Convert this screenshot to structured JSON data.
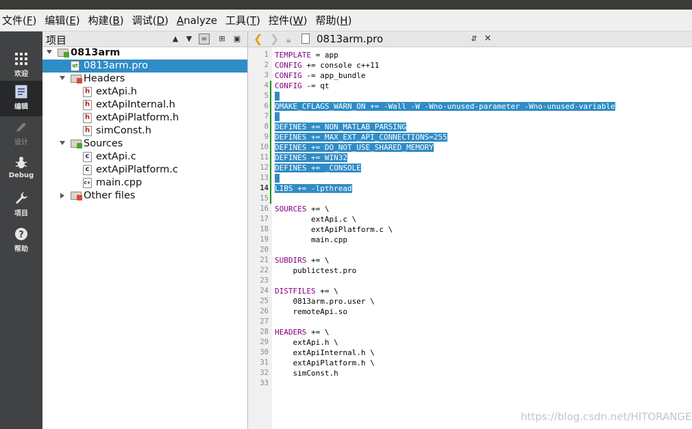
{
  "menu": [
    {
      "text": "文件",
      "key": "F"
    },
    {
      "text": "编辑",
      "key": "E"
    },
    {
      "text": "构建",
      "key": "B"
    },
    {
      "text": "调试",
      "key": "D"
    },
    {
      "text": "Analyze",
      "key": ""
    },
    {
      "text": "工具",
      "key": "T"
    },
    {
      "text": "控件",
      "key": "W"
    },
    {
      "text": "帮助",
      "key": "H"
    }
  ],
  "modes": [
    {
      "label": "欢迎",
      "icon": "grid-icon",
      "state": "normal"
    },
    {
      "label": "编辑",
      "icon": "edit-doc-icon",
      "state": "active"
    },
    {
      "label": "设计",
      "icon": "pencil-icon",
      "state": "disabled"
    },
    {
      "label": "Debug",
      "icon": "bug-icon",
      "state": "normal"
    },
    {
      "label": "项目",
      "icon": "wrench-icon",
      "state": "normal"
    },
    {
      "label": "帮助",
      "icon": "help-icon",
      "state": "normal"
    }
  ],
  "project_pane": {
    "title": "项目",
    "tree": [
      {
        "label": "0813arm",
        "depth": 0,
        "kind": "project",
        "expanded": true,
        "bold": true
      },
      {
        "label": "0813arm.pro",
        "depth": 1,
        "kind": "pro",
        "selected": true
      },
      {
        "label": "Headers",
        "depth": 1,
        "kind": "folder-h",
        "expanded": true
      },
      {
        "label": "extApi.h",
        "depth": 2,
        "kind": "h"
      },
      {
        "label": "extApiInternal.h",
        "depth": 2,
        "kind": "h"
      },
      {
        "label": "extApiPlatform.h",
        "depth": 2,
        "kind": "h"
      },
      {
        "label": "simConst.h",
        "depth": 2,
        "kind": "h"
      },
      {
        "label": "Sources",
        "depth": 1,
        "kind": "folder-c",
        "expanded": true
      },
      {
        "label": "extApi.c",
        "depth": 2,
        "kind": "c"
      },
      {
        "label": "extApiPlatform.c",
        "depth": 2,
        "kind": "c"
      },
      {
        "label": "main.cpp",
        "depth": 2,
        "kind": "cpp"
      },
      {
        "label": "Other files",
        "depth": 1,
        "kind": "folder-o",
        "expanded": false
      }
    ]
  },
  "editor": {
    "file": "0813arm.pro",
    "lines": [
      "TEMPLATE = app",
      "CONFIG += console c++11",
      "CONFIG -= app_bundle",
      "CONFIG -= qt",
      "",
      "QMAKE_CFLAGS_WARN_ON += -Wall -W -Wno-unused-parameter -Wno-unused-variable",
      "",
      "DEFINES += NON_MATLAB_PARSING",
      "DEFINES += MAX_EXT_API_CONNECTIONS=255",
      "DEFINES += DO_NOT_USE_SHARED_MEMORY",
      "DEFINES += WIN32",
      "DEFINES += _CONSOLE",
      "",
      "LIBS += -lpthread",
      "",
      "SOURCES += \\",
      "        extApi.c \\",
      "        extApiPlatform.c \\",
      "        main.cpp",
      "",
      "SUBDIRS += \\",
      "    publictest.pro",
      "",
      "DISTFILES += \\",
      "    0813arm.pro.user \\",
      "    remoteApi.so",
      "",
      "HEADERS += \\",
      "    extApi.h \\",
      "    extApiInternal.h \\",
      "    extApiPlatform.h \\",
      "    simConst.h",
      ""
    ],
    "selected_range": [
      5,
      14
    ],
    "keywords": [
      "TEMPLATE",
      "CONFIG",
      "QMAKE_CFLAGS_WARN_ON",
      "DEFINES",
      "LIBS",
      "SOURCES",
      "SUBDIRS",
      "DISTFILES",
      "HEADERS"
    ]
  },
  "watermark": "https://blog.csdn.net/HITORANGE",
  "colors": {
    "selection": "#308cc6",
    "keyword": "#800080",
    "changebar": "#1f8f1f"
  }
}
